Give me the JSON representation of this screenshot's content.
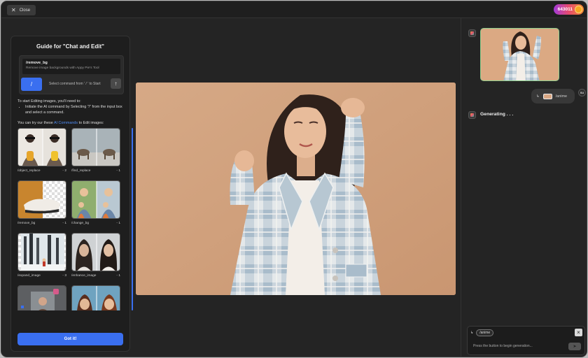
{
  "topbar": {
    "close_label": "Close",
    "credits": "643011"
  },
  "guide": {
    "title": "Guide for \"Chat and Edit\"",
    "command_name": "/remove_bg",
    "command_desc": "Remove image backgrounds with Appy Pie's Tool",
    "slash_label": "/",
    "select_hint": "Select command from ' / ' to Start",
    "intro": "To start Editing images, you'll need to:",
    "step": "Initiate the AI command by Selecting \"/\" from the input box and select a command.",
    "try_prefix": "You can try our these ",
    "try_link": "AI Commands",
    "try_suffix": " to Edit images:",
    "got_it": "Got it!",
    "cards": [
      {
        "name": "/object_replace",
        "count": "- 2"
      },
      {
        "name": "/find_replace",
        "count": "- 1"
      },
      {
        "name": "/remove_bg",
        "count": "- 1"
      },
      {
        "name": "/change_bg",
        "count": "- 1"
      },
      {
        "name": "/expand_image",
        "count": "- 3"
      },
      {
        "name": "/enhance_image",
        "count": "- 1"
      },
      {
        "name": "",
        "count": ""
      },
      {
        "name": "",
        "count": ""
      }
    ]
  },
  "chat": {
    "user_command": "/anime",
    "user_avatar": "SU",
    "status": "Generating . . .",
    "input_chip": "/anime",
    "input_hint": "Press the button to begin generation..."
  },
  "colors": {
    "accent": "#3a6ff0",
    "background": "#242424",
    "photo_bg": "#cfa07c"
  }
}
